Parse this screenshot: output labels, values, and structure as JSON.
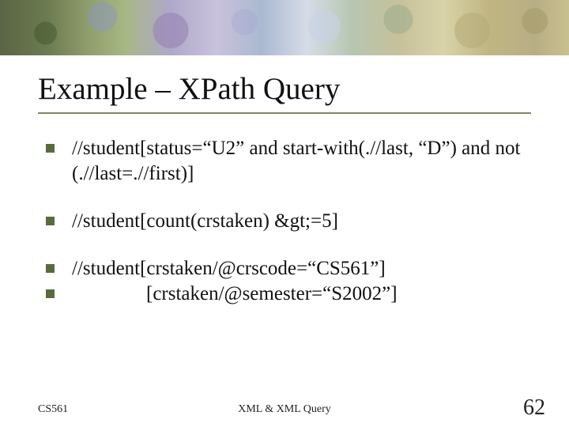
{
  "title": "Example – XPath Query",
  "bullets": {
    "b1": "//student[status=“U2” and start-with(.//last, “D”) and not (.//last=.//first)]",
    "b2": "//student[count(crstaken) &gt;=5]",
    "b3": "//student[crstaken/@crscode=“CS561”]",
    "b4": "[crstaken/@semester=“S2002”]"
  },
  "footer": {
    "left": "CS561",
    "center": "XML & XML Query",
    "right": "62"
  }
}
